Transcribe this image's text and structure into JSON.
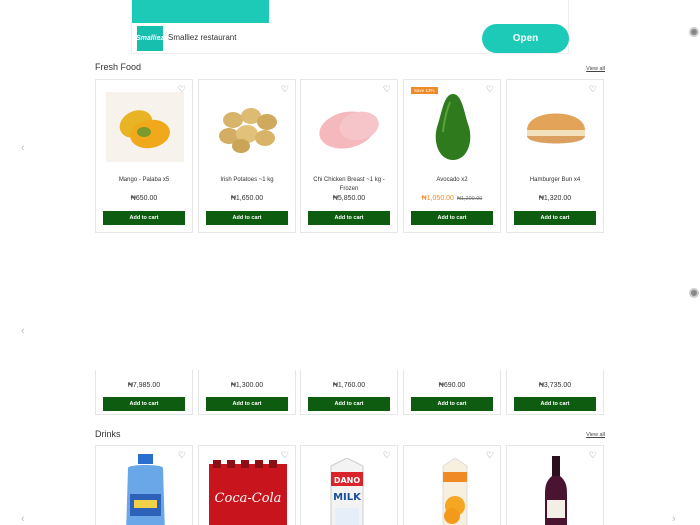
{
  "ad": {
    "name": "Smalliez restaurant",
    "logo_text": "Smalliez",
    "open_label": "Open"
  },
  "fresh_food": {
    "title": "Fresh Food",
    "view_all": "View all",
    "products": [
      {
        "name": "Mango - Palaba x5",
        "price": "₦650.00",
        "add": "Add to cart",
        "icon": "mango-image"
      },
      {
        "name": "Irish Potatoes ~1 kg",
        "price": "₦1,650.00",
        "add": "Add to cart",
        "icon": "potatoes-image"
      },
      {
        "name": "Chi Chicken Breast ~1 kg - Frozen",
        "price": "₦5,850.00",
        "add": "Add to cart",
        "icon": "chicken-breast-image"
      },
      {
        "name": "Avocado x2",
        "price": "₦1,050.00",
        "old_price": "₦1,200.00",
        "badge": "Save 13%",
        "add": "Add to cart",
        "icon": "avocado-image"
      },
      {
        "name": "Hamburger Bun x4",
        "price": "₦1,320.00",
        "add": "Add to cart",
        "icon": "hamburger-bun-image"
      }
    ]
  },
  "row2": [
    {
      "price": "₦7,985.00",
      "add": "Add to cart"
    },
    {
      "price": "₦1,300.00",
      "add": "Add to cart"
    },
    {
      "price": "₦1,760.00",
      "add": "Add to cart"
    },
    {
      "price": "₦690.00",
      "add": "Add to cart"
    },
    {
      "price": "₦3,735.00",
      "add": "Add to cart"
    }
  ],
  "drinks": {
    "title": "Drinks",
    "view_all": "View all",
    "products": [
      {
        "icon": "water-dispenser-bottle-image"
      },
      {
        "icon": "coca-cola-pack-image",
        "text": "Coca-Cola"
      },
      {
        "icon": "dano-milk-image",
        "text": "DANO MILK"
      },
      {
        "icon": "orange-juice-image"
      },
      {
        "icon": "wine-bottle-image"
      }
    ]
  },
  "colors": {
    "teal": "#1dc9b7",
    "button_green": "#0e5c10",
    "sale_orange": "#f08a24"
  }
}
